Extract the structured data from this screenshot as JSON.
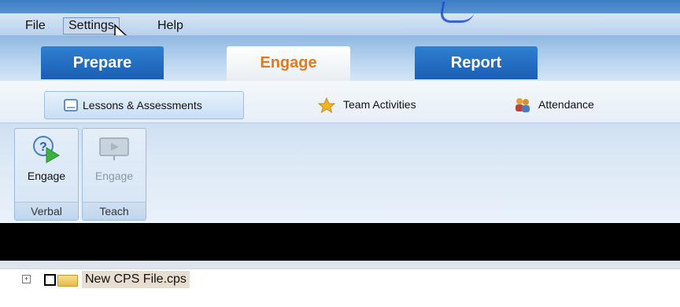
{
  "menu": {
    "file": "File",
    "settings": "Settings",
    "help": "Help"
  },
  "tabs": {
    "prepare": "Prepare",
    "engage": "Engage",
    "report": "Report"
  },
  "subnav": {
    "lessons": "Lessons & Assessments",
    "team": "Team Activities",
    "attendance": "Attendance"
  },
  "ribbon": {
    "verbal": {
      "button": "Engage",
      "group": "Verbal"
    },
    "teach": {
      "button": "Engage",
      "group": "Teach"
    }
  },
  "tree": {
    "file_name": "New CPS File.cps",
    "expander": "+"
  },
  "icons": {
    "lessons": "document-icon",
    "team": "star-icon",
    "attendance": "people-icon",
    "verbal": "question-play-icon",
    "teach": "presentation-icon",
    "tree_folder": "folder-icon",
    "cursor": "mouse-cursor-icon"
  },
  "colors": {
    "accent_blue": "#1a5fb5",
    "active_tab_text": "#e07a1a"
  }
}
